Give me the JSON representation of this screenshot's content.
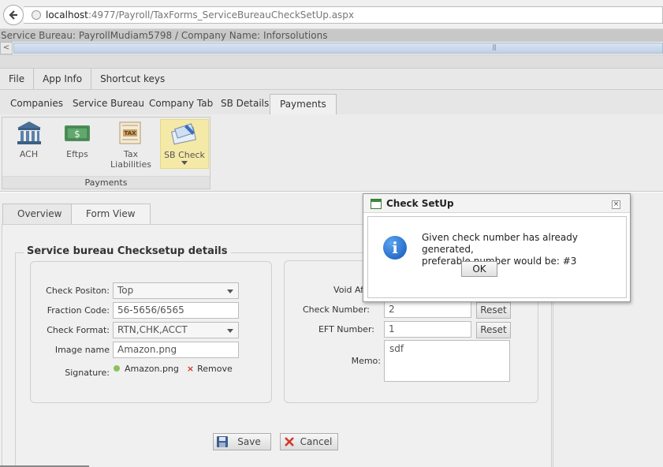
{
  "browser": {
    "url_host": "localhost",
    "url_rest": ":4977/Payroll/TaxForms_ServiceBureauCheckSetUp.aspx"
  },
  "header": {
    "title": "Service Bureau: PayrollMudiam5798 / Company Name: Inforsolutions"
  },
  "menu": [
    "File",
    "App Info",
    "Shortcut keys"
  ],
  "ribbon_tabs": [
    "Companies",
    "Service Bureau",
    "Company Tab",
    "SB Details",
    "Payments"
  ],
  "ribbon": {
    "group_label": "Payments",
    "buttons": [
      "ACH",
      "Eftps",
      "Tax Liabilities",
      "SB Check"
    ],
    "icons": [
      "bank-icon",
      "money-icon",
      "tax-icon",
      "check-icon"
    ]
  },
  "page_tabs": [
    "Overview",
    "Form View"
  ],
  "form": {
    "legend": "Service bureau Checksetup details",
    "left": {
      "check_position_label": "Check Positon:",
      "check_position_value": "Top",
      "fraction_code_label": "Fraction Code:",
      "fraction_code_value": "56-5656/6565",
      "check_format_label": "Check Format:",
      "check_format_value": "RTN,CHK,ACCT",
      "image_name_label": "Image name",
      "image_name_value": "Amazon.png",
      "signature_label": "Signature:",
      "signature_file": "Amazon.png",
      "remove_label": "Remove"
    },
    "right": {
      "void_after_label": "Void Af",
      "check_number_label": "Check Number:",
      "check_number_value": "2",
      "eft_number_label": "EFT Number:",
      "eft_number_value": "1",
      "reset_label": "Reset",
      "memo_label": "Memo:",
      "memo_value": "sdf"
    },
    "save_label": "Save",
    "cancel_label": "Cancel"
  },
  "dialog": {
    "title": "Check SetUp",
    "message_line1": "Given check number has already generated,",
    "message_line2": "preferable number would be: #3",
    "ok_label": "OK"
  },
  "colors": {
    "active_ribbon_button": "#f5e9a8",
    "info_icon": "#1357b8"
  }
}
